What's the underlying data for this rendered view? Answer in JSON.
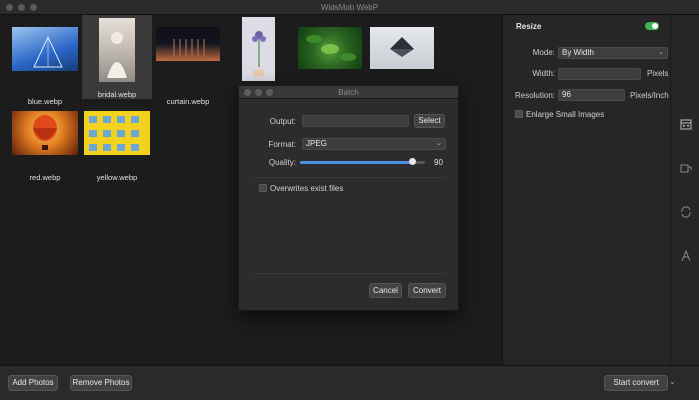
{
  "window": {
    "title": "WidsMob WebP"
  },
  "gallery": {
    "items": [
      {
        "caption": "blue.webp",
        "colors": [
          "#2a66c6",
          "#9fc5f0"
        ]
      },
      {
        "caption": "bridal.webp",
        "colors": [
          "#d9d2c8",
          "#a7a099"
        ]
      },
      {
        "caption": "curtain.webp",
        "colors": [
          "#0f0f16",
          "#c06a40"
        ]
      },
      {
        "caption": "",
        "colors": [
          "#dcdbe6",
          "#6f5fa8"
        ]
      },
      {
        "caption": "",
        "colors": [
          "#0f3b12",
          "#5aa23a"
        ]
      },
      {
        "caption": "",
        "colors": [
          "#d9dde2",
          "#2b3038"
        ]
      },
      {
        "caption": "red.webp",
        "colors": [
          "#f0b040",
          "#7a2a10"
        ]
      },
      {
        "caption": "yellow.webp",
        "colors": [
          "#f2d21c",
          "#6aa7d6"
        ]
      }
    ]
  },
  "resize": {
    "title": "Resize",
    "mode_label": "Mode:",
    "mode_value": "By Width",
    "width_label": "Width:",
    "width_value": "",
    "width_unit": "Pixels",
    "resolution_label": "Resolution:",
    "resolution_value": "96",
    "resolution_unit": "Pixels/Inch",
    "enlarge_label": "Enlarge Small Images"
  },
  "rail": {
    "icons": [
      "calendar-icon",
      "crop-icon",
      "rotate-icon",
      "text-icon"
    ]
  },
  "batch": {
    "title": "Batch",
    "output_label": "Output:",
    "output_value": "",
    "select_label": "Select",
    "format_label": "Format:",
    "format_value": "JPEG",
    "quality_label": "Quality:",
    "quality_value": "90",
    "quality_fraction": 0.9,
    "overwrite_label": "Overwrites exist files",
    "cancel_label": "Cancel",
    "convert_label": "Convert"
  },
  "bottom": {
    "add_label": "Add Photos",
    "remove_label": "Remove Photos",
    "start_label": "Start convert"
  },
  "accent": {
    "toggle": "#3fb34f",
    "slider": "#4a8fe7"
  }
}
